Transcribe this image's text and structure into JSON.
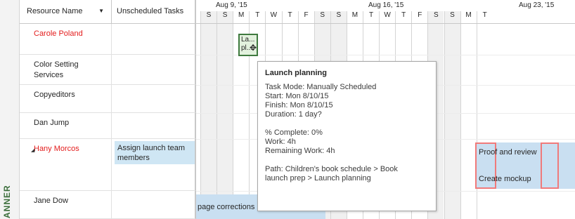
{
  "view_label": "ANNER",
  "columns": {
    "resource_name": "Resource Name",
    "unscheduled_tasks": "Unscheduled Tasks"
  },
  "resources": [
    {
      "name": "Carole Poland",
      "highlight": true
    },
    {
      "name": "Color Setting Services",
      "highlight": false
    },
    {
      "name": "Copyeditors",
      "highlight": false
    },
    {
      "name": "Dan Jump",
      "highlight": false
    },
    {
      "name": "Hany Morcos",
      "highlight": true,
      "expander": "◢",
      "unscheduled_task": "Assign launch team members"
    },
    {
      "name": "Jane Dow",
      "highlight": false
    }
  ],
  "timeline": {
    "weeks": [
      "Aug 9, '15",
      "Aug 16, '15",
      "Aug 23, '15"
    ],
    "days": [
      "S",
      "S",
      "M",
      "T",
      "W",
      "T",
      "F",
      "S",
      "S",
      "M",
      "T",
      "W",
      "T",
      "F",
      "S",
      "S",
      "M",
      "T"
    ]
  },
  "gantt": {
    "selected_task_text": "La... pl...",
    "bars": {
      "proof": "Proof and review",
      "create": "Create mockup",
      "page": "page corrections"
    }
  },
  "tooltip": {
    "title": "Launch planning",
    "task_mode": "Task Mode: Manually Scheduled",
    "start": "Start: Mon 8/10/15",
    "finish": "Finish: Mon 8/10/15",
    "duration": "Duration: 1 day?",
    "percent_complete": "% Complete: 0%",
    "work": "Work: 4h",
    "remaining_work": "Remaining Work: 4h",
    "path_line1": "Path: Children's book schedule > Book",
    "path_line2": "launch prep > Launch planning"
  },
  "colors": {
    "overallocated": "#e31c1c",
    "bar": "#c9dff1",
    "selected_border": "#3f7a3f"
  }
}
